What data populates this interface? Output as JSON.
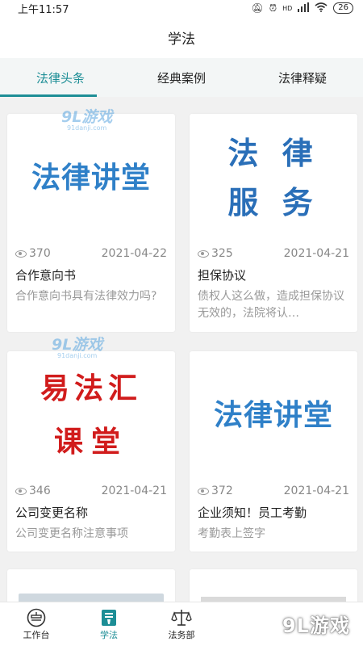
{
  "status_bar": {
    "time": "上午11:57",
    "network": "HD",
    "battery": "26"
  },
  "header": {
    "title": "学法"
  },
  "tabs": [
    {
      "label": "法律头条",
      "active": true
    },
    {
      "label": "经典案例",
      "active": false
    },
    {
      "label": "法律释疑",
      "active": false
    }
  ],
  "cards": [
    {
      "thumb_lines": [
        "法律讲堂"
      ],
      "views": "370",
      "date": "2021-04-22",
      "title": "合作意向书",
      "desc": "合作意向书具有法律效力吗?"
    },
    {
      "thumb_lines": [
        "法 律",
        "服 务"
      ],
      "views": "325",
      "date": "2021-04-21",
      "title": "担保协议",
      "desc": "债权人这么做，造成担保协议无效的，法院将认…"
    },
    {
      "thumb_lines": [
        "易法汇",
        "课堂"
      ],
      "views": "346",
      "date": "2021-04-21",
      "title": "公司变更名称",
      "desc": "公司变更名称注意事项"
    },
    {
      "thumb_lines": [
        "法律讲堂"
      ],
      "views": "372",
      "date": "2021-04-21",
      "title": "企业须知！员工考勤",
      "desc": "考勤表上签字"
    }
  ],
  "watermark": {
    "logo": "9L游戏",
    "url": "91danji.com"
  },
  "bottom_nav": [
    {
      "label": "工作台",
      "icon": "workbench-icon",
      "active": false
    },
    {
      "label": "学法",
      "icon": "law-study-icon",
      "active": true
    },
    {
      "label": "法务部",
      "icon": "scales-icon",
      "active": false
    }
  ],
  "brand_watermark": "9L游戏",
  "colors": {
    "accent": "#1d8e96",
    "thumb_blue": "#2f80c8",
    "thumb_red": "#d11c1c"
  }
}
